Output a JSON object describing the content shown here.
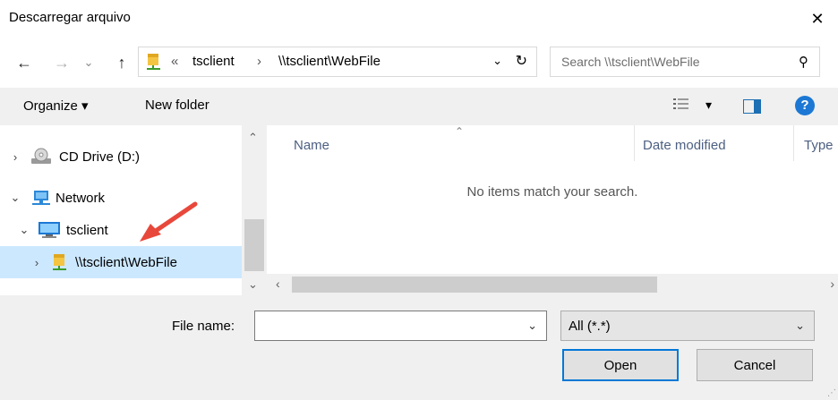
{
  "window": {
    "title": "Descarregar arquivo",
    "close_glyph": "✕"
  },
  "nav": {
    "back_glyph": "←",
    "forward_glyph": "→",
    "recent_glyph": "⌄",
    "up_glyph": "↑",
    "address": {
      "prefix": "«",
      "crumb1": "tsclient",
      "sep": "›",
      "crumb2": "\\\\tsclient\\WebFile",
      "dropdown_glyph": "⌄",
      "refresh_glyph": "↻"
    },
    "search": {
      "placeholder": "Search \\\\tsclient\\WebFile",
      "icon_glyph": "⚲"
    }
  },
  "toolbar": {
    "organize_label": "Organize ▾",
    "new_folder_label": "New folder",
    "view_dropdown_glyph": "▾",
    "help_glyph": "?"
  },
  "tree": {
    "items": [
      {
        "label": "CD Drive (D:)",
        "chevron": "›",
        "icon": "cd-drive-icon"
      },
      {
        "label": "Network",
        "chevron": "⌄",
        "icon": "network-icon"
      },
      {
        "label": "tsclient",
        "chevron": "⌄",
        "icon": "computer-icon"
      },
      {
        "label": "\\\\tsclient\\WebFile",
        "chevron": "›",
        "icon": "network-folder-icon"
      }
    ],
    "scroll_up_glyph": "⌃",
    "scroll_down_glyph": "⌄"
  },
  "file_list": {
    "columns": [
      "Name",
      "Date modified",
      "Type"
    ],
    "sort_glyph": "⌃",
    "empty_message": "No items match your search.",
    "scroll_left_glyph": "‹",
    "scroll_right_glyph": "›"
  },
  "footer": {
    "file_name_label": "File name:",
    "file_name_value": "",
    "file_name_dropdown_glyph": "⌄",
    "filter_value": "All (*.*)",
    "filter_dropdown_glyph": "⌄",
    "open_label": "Open",
    "cancel_label": "Cancel",
    "grip_glyph": "⋰"
  },
  "colors": {
    "accent": "#0078d7",
    "selection": "#cce8ff",
    "annotation_arrow": "#e8483b"
  }
}
